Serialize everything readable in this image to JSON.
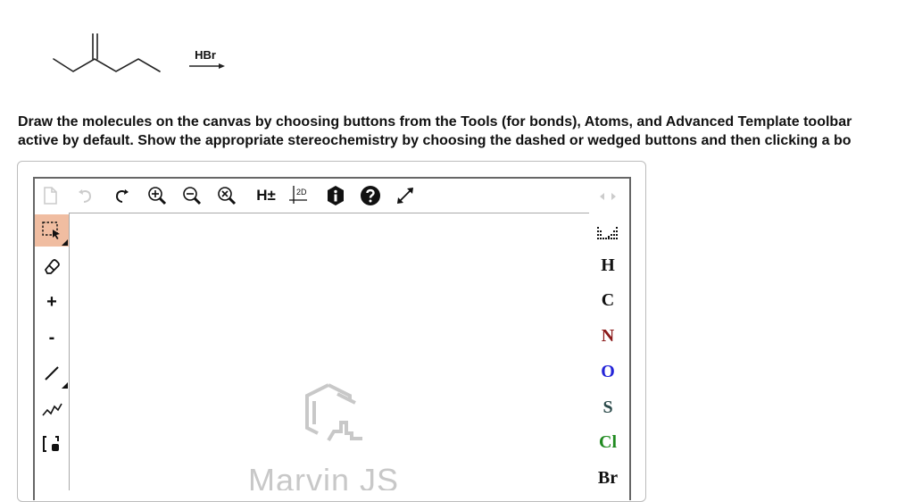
{
  "reaction": {
    "reagent": "HBr"
  },
  "instructions": {
    "line1": "Draw the molecules on the canvas by choosing buttons from the Tools (for bonds), Atoms, and Advanced Template toolbar",
    "line2": "active by default. Show the appropriate stereochemistry by choosing the dashed or wedged buttons and then clicking a bo"
  },
  "toolbar": {
    "items": [
      {
        "name": "new-document-icon"
      },
      {
        "name": "undo-icon"
      },
      {
        "name": "redo-icon"
      },
      {
        "name": "zoom-in-icon"
      },
      {
        "name": "zoom-out-icon"
      },
      {
        "name": "zoom-fit-icon"
      },
      {
        "name": "hydrogens-toggle",
        "label": "H±"
      },
      {
        "name": "clean-2d-icon",
        "label": "2D"
      },
      {
        "name": "info-icon"
      },
      {
        "name": "help-icon"
      },
      {
        "name": "fullscreen-icon"
      }
    ]
  },
  "left_tools": {
    "plus_label": "+",
    "minus_label": "-"
  },
  "atoms": {
    "items": [
      {
        "symbol": "H",
        "color": "#111111"
      },
      {
        "symbol": "C",
        "color": "#111111"
      },
      {
        "symbol": "N",
        "color": "#8b1a1a"
      },
      {
        "symbol": "O",
        "color": "#2323d8"
      },
      {
        "symbol": "S",
        "color": "#2b4a4a"
      },
      {
        "symbol": "Cl",
        "color": "#1f8a1f"
      },
      {
        "symbol": "Br",
        "color": "#111111"
      }
    ]
  },
  "canvas": {
    "watermark": "Marvin JS"
  },
  "colors": {
    "active_tool": "#f0bda1",
    "disabled": "#cccccc"
  }
}
